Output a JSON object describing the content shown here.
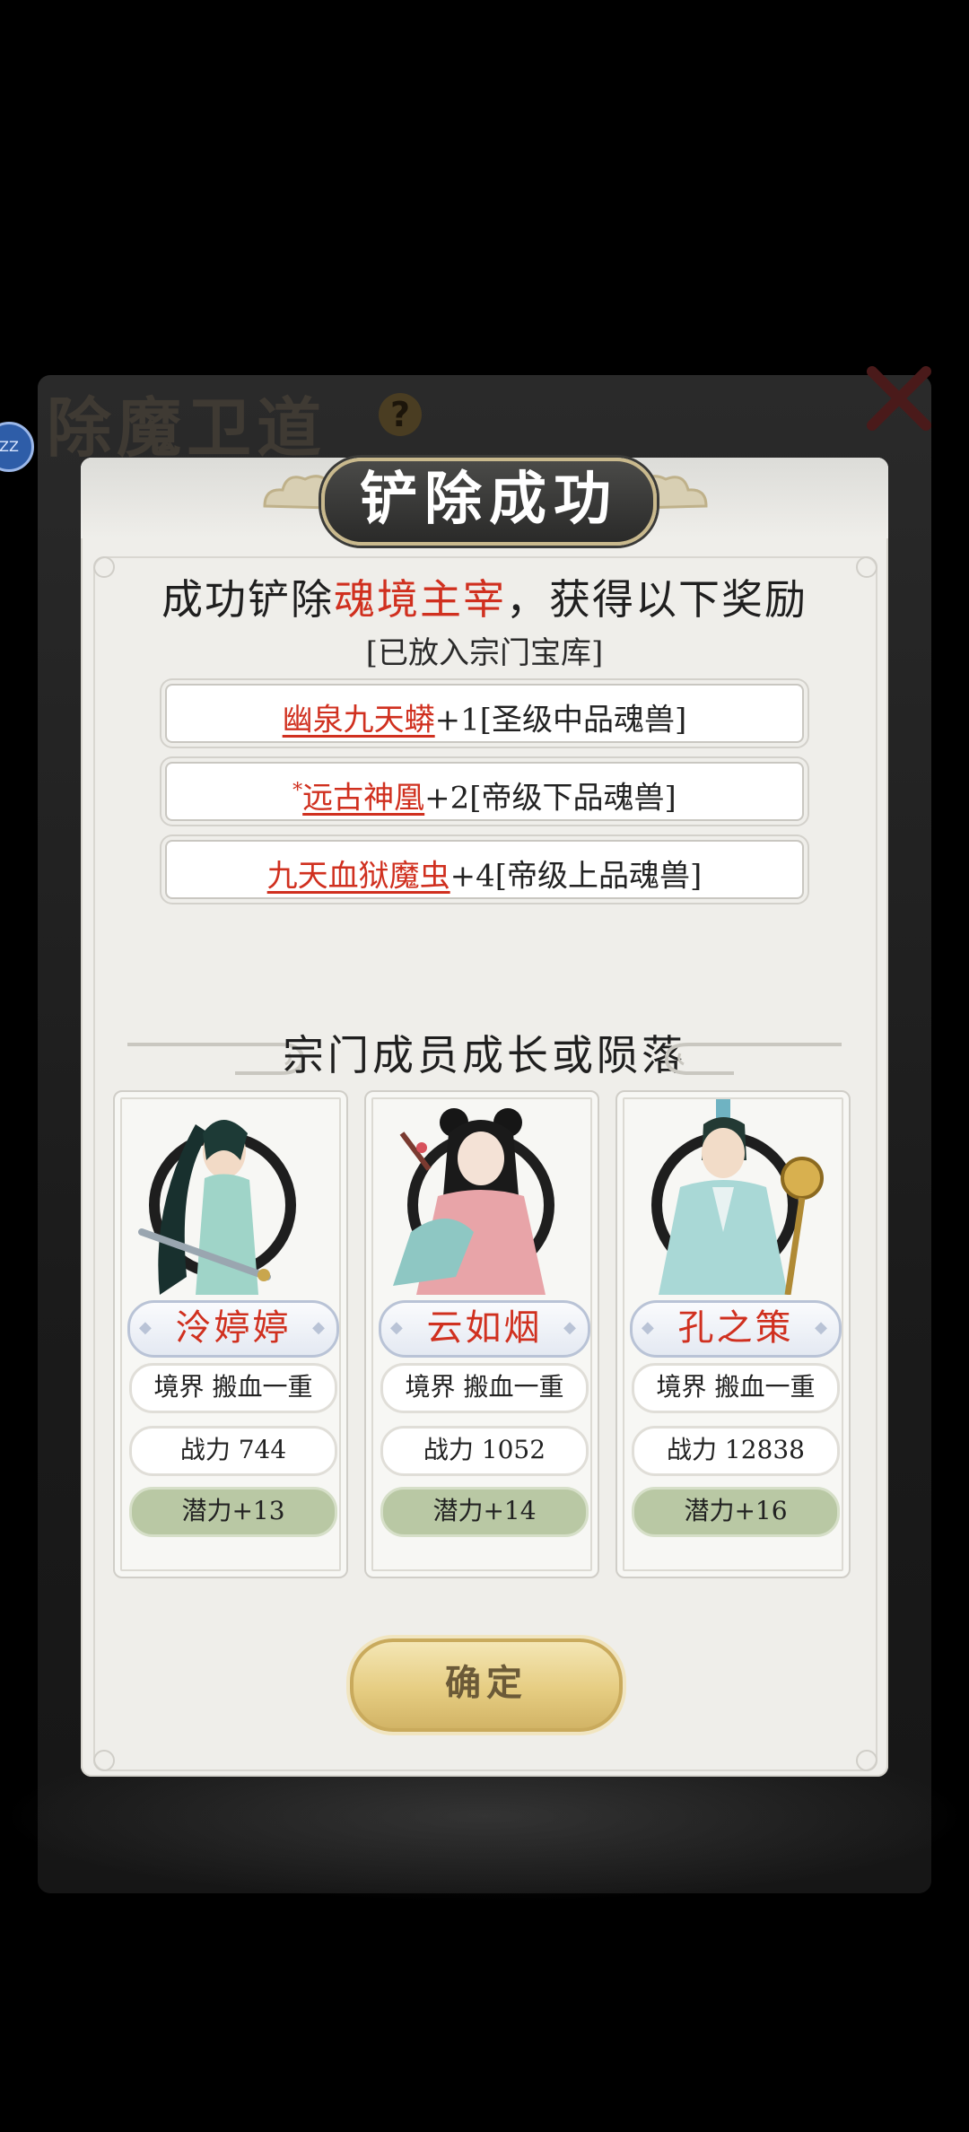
{
  "background": {
    "title": "除魔卫道",
    "help_label": "?",
    "badge_text": "ZZ"
  },
  "dialog": {
    "title": "铲除成功",
    "headline_prefix": "成功铲除",
    "headline_boss": "魂境主宰",
    "headline_suffix": "，获得以下奖励",
    "subline": "[已放入宗门宝库]",
    "rewards": [
      {
        "star": "",
        "name": "幽泉九天蟒",
        "detail": "+1[圣级中品魂兽]"
      },
      {
        "star": "*",
        "name": "远古神凰",
        "detail": "+2[帝级下品魂兽]"
      },
      {
        "star": "",
        "name": "九天血狱魔虫",
        "detail": "+4[帝级上品魂兽]"
      }
    ],
    "members_title": "宗门成员成长或陨落",
    "members": [
      {
        "name": "泠婷婷",
        "realm": "境界 搬血一重",
        "power": "战力 744",
        "potential": "潜力+13"
      },
      {
        "name": "云如烟",
        "realm": "境界 搬血一重",
        "power": "战力 1052",
        "potential": "潜力+14"
      },
      {
        "name": "孔之策",
        "realm": "境界 搬血一重",
        "power": "战力 12838",
        "potential": "潜力+16"
      }
    ],
    "confirm_label": "确定"
  },
  "colors": {
    "accent_red": "#d0301f",
    "potential_green": "#b9c8a4",
    "gold_button": "#e6cd82"
  }
}
